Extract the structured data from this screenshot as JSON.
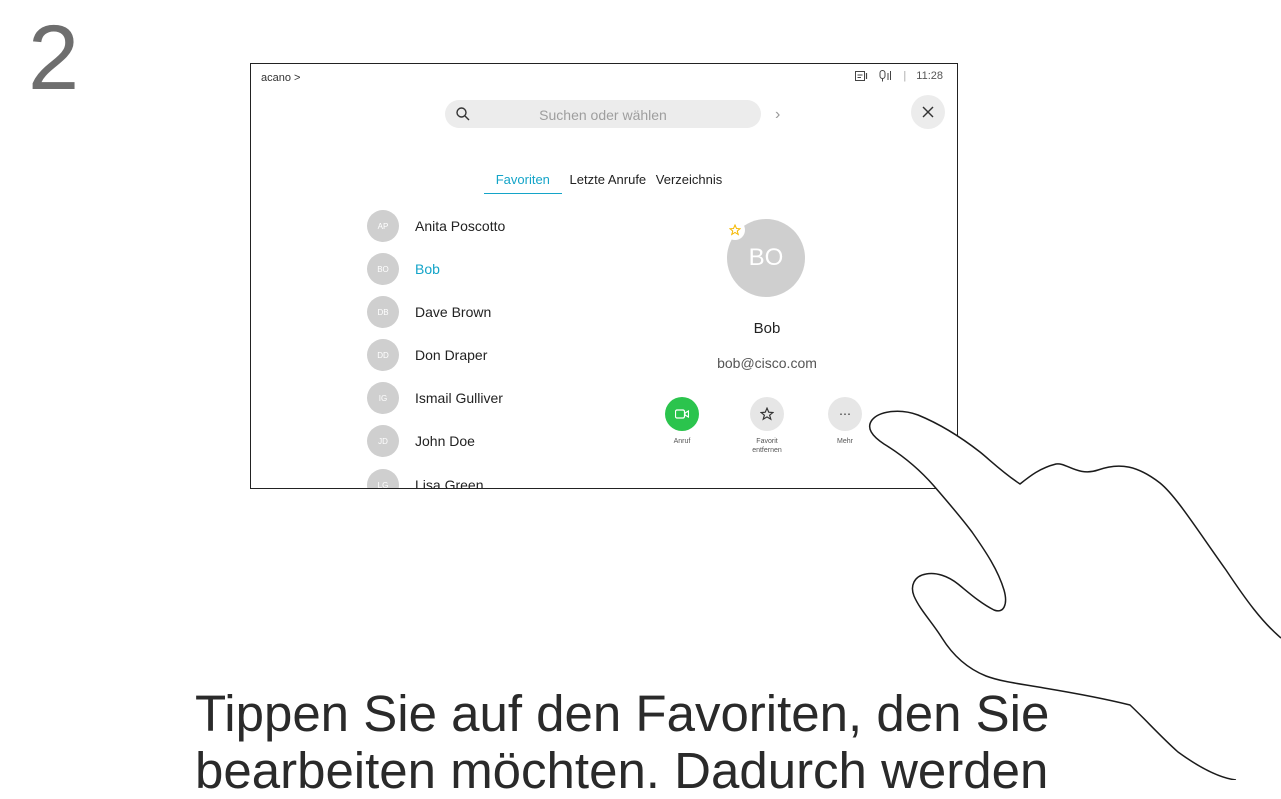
{
  "step_number": "2",
  "topbar": {
    "breadcrumb": "acano >",
    "time": "11:28"
  },
  "search": {
    "placeholder": "Suchen oder wählen"
  },
  "tabs": [
    {
      "label": "Favoriten",
      "active": true
    },
    {
      "label": "Letzte Anrufe",
      "active": false
    },
    {
      "label": "Verzeichnis",
      "active": false
    }
  ],
  "contacts": [
    {
      "initials": "AP",
      "name": "Anita Poscotto"
    },
    {
      "initials": "BO",
      "name": "Bob",
      "active": true
    },
    {
      "initials": "DB",
      "name": "Dave Brown"
    },
    {
      "initials": "DD",
      "name": "Don Draper"
    },
    {
      "initials": "IG",
      "name": "Ismail Gulliver"
    },
    {
      "initials": "JD",
      "name": "John Doe"
    },
    {
      "initials": "LG",
      "name": "Lisa Green"
    }
  ],
  "detail": {
    "initials": "BO",
    "name": "Bob",
    "email": "bob@cisco.com",
    "actions": [
      {
        "icon": "video-call-icon",
        "label": "Anruf"
      },
      {
        "icon": "star-icon",
        "label": "Favorit entfernen"
      },
      {
        "icon": "more-icon",
        "label": "Mehr"
      }
    ]
  },
  "caption": "Tippen Sie auf den Favoriten, den Sie bearbeiten möchten. Dadurch werden",
  "colors": {
    "accent": "#14a4c8",
    "call_green": "#2bc44d",
    "favorite_star": "#f5b800"
  }
}
